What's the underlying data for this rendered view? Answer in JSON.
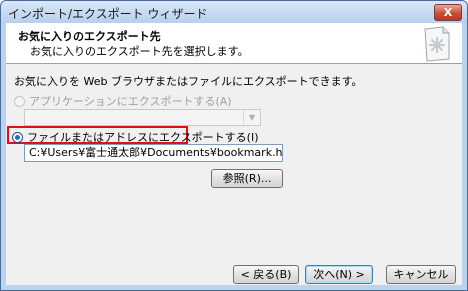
{
  "window": {
    "title": "インポート/エクスポート ウィザード",
    "close_label": "X"
  },
  "header": {
    "title": "お気に入りのエクスポート先",
    "subtitle": "お気に入りのエクスポート先を選択します。"
  },
  "body": {
    "description": "お気に入りを Web ブラウザまたはファイルにエクスポートできます。",
    "option_app": {
      "label": "アプリケーションにエクスポートする(A)",
      "checked": false,
      "enabled": false
    },
    "app_select": {
      "value": ""
    },
    "option_file": {
      "label": "ファイルまたはアドレスにエクスポートする(I)",
      "checked": true,
      "enabled": true
    },
    "file_path": "C:¥Users¥富士通太郎¥Documents¥bookmark.htm",
    "browse_label": "参照(R)..."
  },
  "footer": {
    "back_label": "< 戻る(B)",
    "next_label": "次へ(N) >",
    "cancel_label": "キャンセル"
  },
  "colors": {
    "highlight": "#e01010",
    "title_bar": "#b7cfee"
  }
}
